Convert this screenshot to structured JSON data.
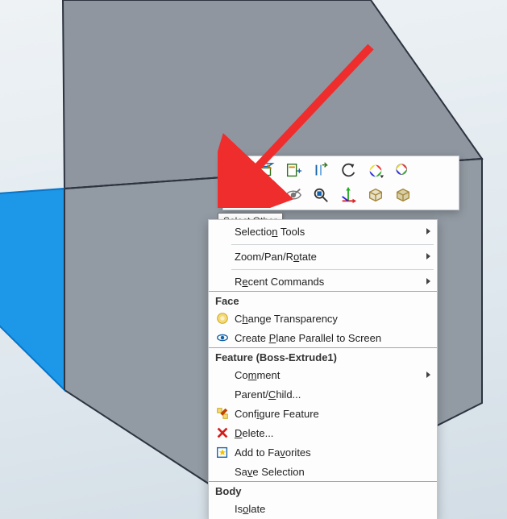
{
  "tooltip_text": "Select Other",
  "quick_toolbar": {
    "row1": [
      {
        "name": "zoom-to-fit-icon"
      },
      {
        "name": "sketch-icon"
      },
      {
        "name": "import-dxf-icon"
      },
      {
        "name": "offset-entities-icon"
      },
      {
        "name": "undo-icon"
      },
      {
        "name": "appearance-icon"
      },
      {
        "name": "body-appearance-icon"
      }
    ],
    "row2": [
      {
        "name": "select-other-icon"
      },
      {
        "name": "normal-to-icon"
      },
      {
        "name": "hide-icon"
      },
      {
        "name": "zoom-to-selection-icon"
      },
      {
        "name": "move-triad-icon"
      },
      {
        "name": "box-display-icon"
      },
      {
        "name": "solid-display-icon"
      }
    ]
  },
  "menu": {
    "top_items": [
      {
        "label_html": "Selectio<u>n</u> Tools",
        "submenu": true
      },
      {
        "label_html": "Zoom/Pan/R<u>o</u>tate",
        "submenu": true
      },
      {
        "label_html": "R<u>e</u>cent Commands",
        "submenu": true
      }
    ],
    "sections": [
      {
        "header": "Face",
        "items": [
          {
            "label_html": "C<u>h</u>ange Transparency",
            "icon": "transparency-icon"
          },
          {
            "label_html": "Create <u>P</u>lane Parallel to Screen",
            "icon": "plane-parallel-icon"
          }
        ]
      },
      {
        "header": "Feature (Boss-Extrude1)",
        "items": [
          {
            "label_html": "Co<u>m</u>ment",
            "submenu": true
          },
          {
            "label_html": "Parent/<u>C</u>hild..."
          },
          {
            "label_html": "Conf<u>i</u>gure Feature",
            "icon": "configure-feature-icon"
          },
          {
            "label_html": "<u>D</u>elete...",
            "icon": "delete-icon"
          },
          {
            "label_html": "Add to Fa<u>v</u>orites",
            "icon": "favorites-icon"
          },
          {
            "label_html": "Sa<u>v</u>e Selection"
          }
        ]
      },
      {
        "header": "Body",
        "items": [
          {
            "label_html": "Is<u>o</u>late"
          }
        ]
      }
    ]
  }
}
